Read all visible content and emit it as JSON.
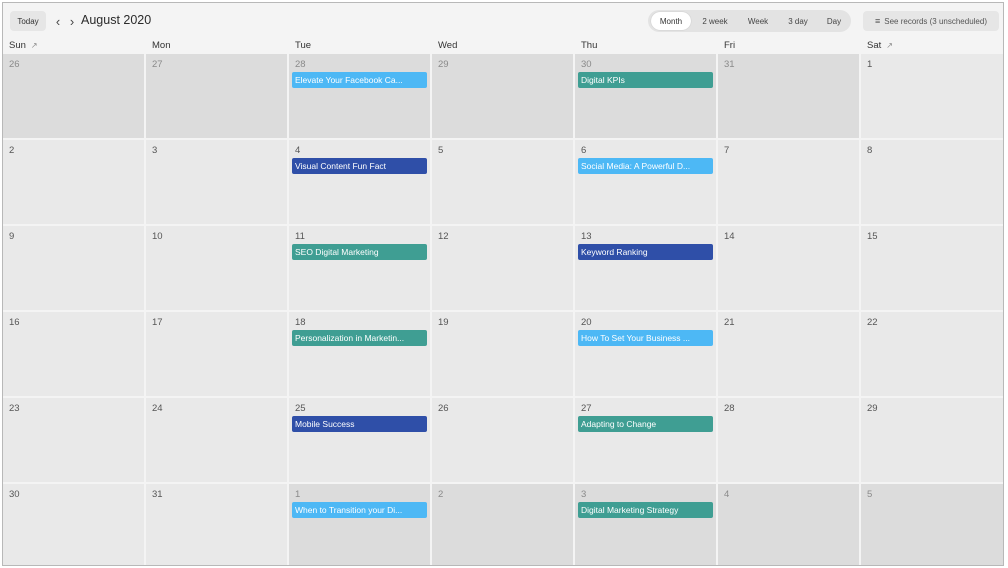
{
  "toolbar": {
    "today_label": "Today",
    "prev_icon": "chevron-left-icon",
    "next_icon": "chevron-right-icon",
    "month_title": "August 2020",
    "views": [
      "Month",
      "2 week",
      "Week",
      "3 day",
      "Day"
    ],
    "active_view": "Month",
    "see_records_icon": "list-icon",
    "see_records_label": "See records (3 unscheduled)"
  },
  "weekdays": [
    "Sun",
    "Mon",
    "Tue",
    "Wed",
    "Thu",
    "Fri",
    "Sat"
  ],
  "colors": {
    "light_blue": "#4db8f5",
    "teal": "#3f9e93",
    "navy": "#2f4fa8"
  },
  "weeks": [
    [
      {
        "day": "26",
        "muted": true
      },
      {
        "day": "27",
        "muted": true
      },
      {
        "day": "28",
        "muted": true,
        "event": "Elevate Your Facebook Ca...",
        "color": "light_blue"
      },
      {
        "day": "29",
        "muted": true
      },
      {
        "day": "30",
        "muted": true,
        "event": "Digital KPIs",
        "color": "teal"
      },
      {
        "day": "31",
        "muted": true
      },
      {
        "day": "1"
      }
    ],
    [
      {
        "day": "2"
      },
      {
        "day": "3"
      },
      {
        "day": "4",
        "event": "Visual Content Fun Fact",
        "color": "navy"
      },
      {
        "day": "5"
      },
      {
        "day": "6",
        "event": "Social Media: A Powerful D...",
        "color": "light_blue"
      },
      {
        "day": "7"
      },
      {
        "day": "8"
      }
    ],
    [
      {
        "day": "9"
      },
      {
        "day": "10"
      },
      {
        "day": "11",
        "event": "SEO Digital Marketing",
        "color": "teal"
      },
      {
        "day": "12"
      },
      {
        "day": "13",
        "event": "Keyword Ranking",
        "color": "navy"
      },
      {
        "day": "14"
      },
      {
        "day": "15"
      }
    ],
    [
      {
        "day": "16"
      },
      {
        "day": "17"
      },
      {
        "day": "18",
        "event": "Personalization in Marketin...",
        "color": "teal"
      },
      {
        "day": "19"
      },
      {
        "day": "20",
        "event": "How To Set Your Business ...",
        "color": "light_blue"
      },
      {
        "day": "21"
      },
      {
        "day": "22"
      }
    ],
    [
      {
        "day": "23"
      },
      {
        "day": "24"
      },
      {
        "day": "25",
        "event": "Mobile Success",
        "color": "navy"
      },
      {
        "day": "26"
      },
      {
        "day": "27",
        "event": "Adapting to Change",
        "color": "teal"
      },
      {
        "day": "28"
      },
      {
        "day": "29"
      }
    ],
    [
      {
        "day": "30"
      },
      {
        "day": "31"
      },
      {
        "day": "1",
        "muted": true,
        "event": "When to Transition your Di...",
        "color": "light_blue"
      },
      {
        "day": "2",
        "muted": true
      },
      {
        "day": "3",
        "muted": true,
        "event": "Digital Marketing Strategy",
        "color": "teal"
      },
      {
        "day": "4",
        "muted": true
      },
      {
        "day": "5",
        "muted": true
      }
    ]
  ]
}
